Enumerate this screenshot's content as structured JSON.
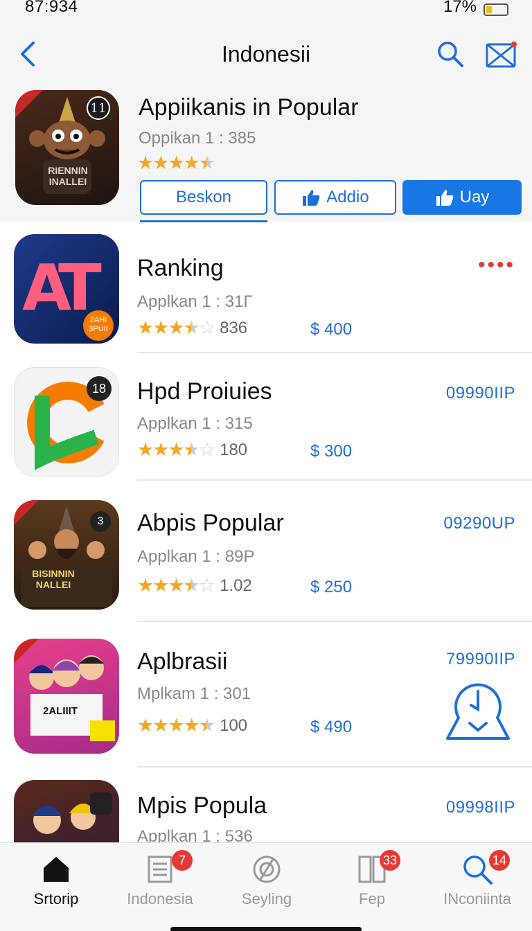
{
  "status_bar": {
    "time": "87:934",
    "battery": "17%"
  },
  "header": {
    "title": "Indonesii"
  },
  "featured": {
    "title": "Appiikanis in Popular",
    "subtitle": "Oppikan 1 : 385",
    "rating": 4.5,
    "icon_badge": "11",
    "icon_caption": "RIENNIN INALLEI",
    "buttons": [
      {
        "label": "Beskon",
        "icon": "none"
      },
      {
        "label": "Addio",
        "icon": "thumbs-up-icon"
      },
      {
        "label": "Uay",
        "icon": "thumbs-up-icon"
      }
    ]
  },
  "apps": [
    {
      "title": "Ranking",
      "subtitle": "Applkan 1 : 31Г",
      "rating": 3.5,
      "count": "836",
      "price": "$ 400",
      "right": "",
      "icon_text": "AT",
      "icon_badge": "2AHI 3PUII"
    },
    {
      "title": "Hpd Proiuies",
      "subtitle": "Applkan 1 : 315",
      "rating": 3.5,
      "count": "180",
      "price": "$ 300",
      "right": "09990IIP",
      "icon_text": "C",
      "icon_badge": "18"
    },
    {
      "title": "Abpis Popular",
      "subtitle": "Applkan 1 : 89P",
      "rating": 3.5,
      "count": "1.02",
      "price": "$ 250",
      "right": "09290UP",
      "icon_text": "BISINNIN NALLEI",
      "icon_badge": "3"
    },
    {
      "title": "Aplbrasii",
      "subtitle": "Mplkam 1 : 301",
      "rating": 4.5,
      "count": "100",
      "price": "$ 490",
      "right": "79990IIP",
      "icon_text": "2ALIIIT",
      "icon_badge": ""
    },
    {
      "title": "Mpis Popula",
      "subtitle": "Applkan 1 : 536",
      "rating": 0,
      "count": "",
      "price": "",
      "right": "09998IIP",
      "icon_text": "",
      "icon_badge": ""
    }
  ],
  "tabs": [
    {
      "label": "Srtorip",
      "icon": "home-icon",
      "badge": "",
      "active": true
    },
    {
      "label": "Indonesia",
      "icon": "document-list-icon",
      "badge": "7",
      "active": false
    },
    {
      "label": "Seyling",
      "icon": "compass-icon",
      "badge": "",
      "active": false
    },
    {
      "label": "Fep",
      "icon": "grid-icon",
      "badge": "33",
      "active": false
    },
    {
      "label": "INconiinta",
      "icon": "search-icon",
      "badge": "14",
      "active": false
    }
  ],
  "colors": {
    "accent": "#1977e5",
    "star": "#f5a623",
    "badge": "#e53935"
  }
}
